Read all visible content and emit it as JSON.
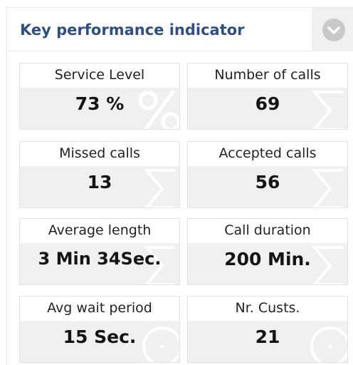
{
  "widget": {
    "title": "Key performance indicator",
    "collapse_icon": "chevron-down-circle-icon"
  },
  "kpis": [
    {
      "label": "Service Level",
      "value": "73 %",
      "icon": "percent-icon"
    },
    {
      "label": "Number of calls",
      "value": "69",
      "icon": "sigma-icon"
    },
    {
      "label": "Missed calls",
      "value": "13",
      "icon": "sigma-icon"
    },
    {
      "label": "Accepted calls",
      "value": "56",
      "icon": "sigma-icon"
    },
    {
      "label": "Average length",
      "value": "3 Min 34Sec.",
      "icon": "sigma-icon"
    },
    {
      "label": "Call duration",
      "value": "200 Min.",
      "icon": "sigma-icon"
    },
    {
      "label": "Avg wait period",
      "value": "15 Sec.",
      "icon": "clock-icon"
    },
    {
      "label": "Nr. Custs.",
      "value": "21",
      "icon": "clock-icon"
    }
  ],
  "colors": {
    "title": "#2f4f84",
    "tile_bg": "#f0f0f0",
    "chevron_bg": "#c9c9c9"
  }
}
